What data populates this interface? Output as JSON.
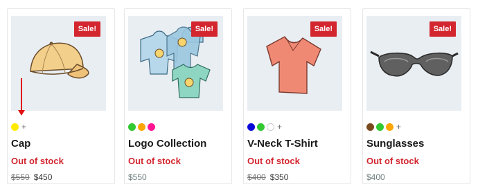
{
  "products": [
    {
      "sale_label": "Sale!",
      "name": "Cap",
      "stock": "Out of stock",
      "old_price": "$550",
      "price": "$450",
      "swatches": [
        "#ffea00"
      ],
      "more": "+",
      "image_icon": "cap-icon"
    },
    {
      "sale_label": "Sale!",
      "name": "Logo Collection",
      "stock": "Out of stock",
      "old_price": "",
      "price": "$550",
      "swatches": [
        "#32c832",
        "#ffa500",
        "#ff1493"
      ],
      "more": "+",
      "image_icon": "apparel-collection-icon"
    },
    {
      "sale_label": "Sale!",
      "name": "V-Neck T-Shirt",
      "stock": "Out of stock",
      "old_price": "$400",
      "price": "$350",
      "swatches": [
        "#0a0ad8",
        "#32c832",
        "#ffffff"
      ],
      "more": "+",
      "image_icon": "tshirt-icon"
    },
    {
      "sale_label": "Sale!",
      "name": "Sunglasses",
      "stock": "Out of stock",
      "old_price": "",
      "price": "$400",
      "swatches": [
        "#7a4a1e",
        "#32c832",
        "#ffa500"
      ],
      "more": "+",
      "image_icon": "sunglasses-icon"
    }
  ]
}
